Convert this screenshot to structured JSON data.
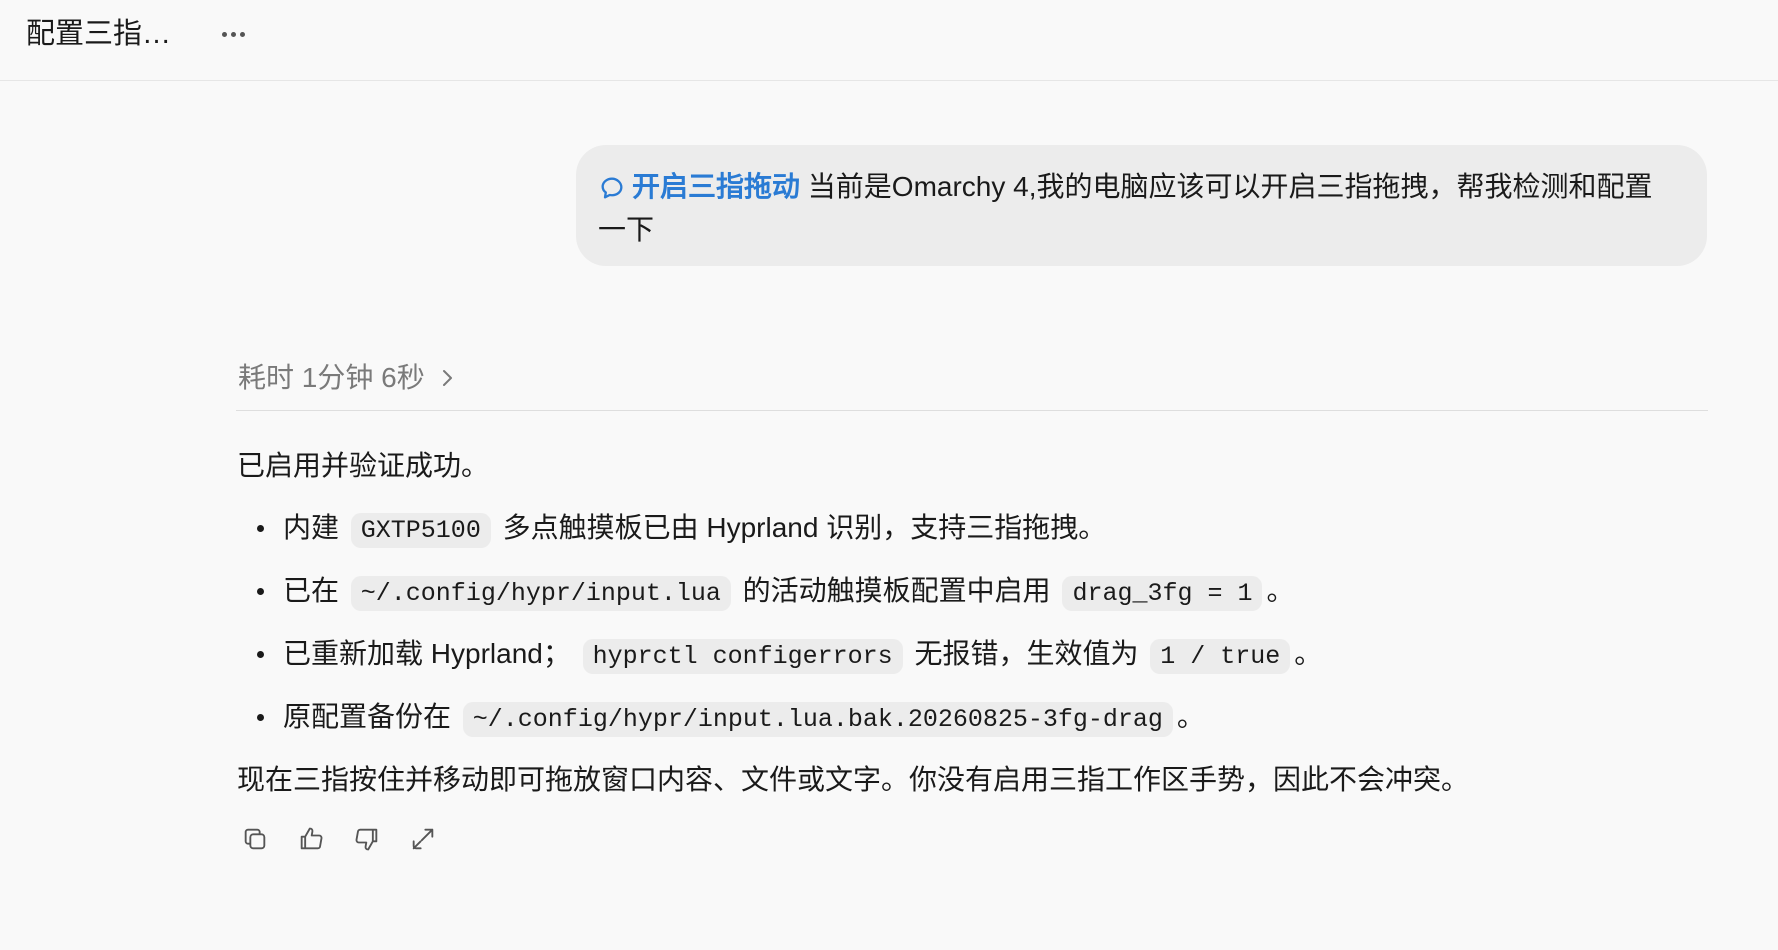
{
  "header": {
    "title": "配置三指…",
    "more_icon": "more-horizontal-icon"
  },
  "user_message": {
    "skill_icon": "chat-bubble-icon",
    "skill_label": "开启三指拖动",
    "text_line1": "当前是Omarchy 4,我的电脑应该可以开启三指拖拽，帮我检测和配置",
    "text_line2": "一下"
  },
  "assistant": {
    "elapsed": "耗时 1分钟 6秒",
    "elapsed_icon": "chevron-right-icon",
    "intro": "已启用并验证成功。",
    "bullets": [
      {
        "pre": "内建",
        "code1": "GXTP5100",
        "mid": "多点触摸板已由 Hyprland 识别，支持三指拖拽。"
      },
      {
        "pre": "已在",
        "code1": "~/.config/hypr/input.lua",
        "mid": "的活动触摸板配置中启用",
        "code2": "drag_3fg = 1",
        "post": "。"
      },
      {
        "pre": "已重新加载 Hyprland；",
        "code1": "hyprctl configerrors",
        "mid": "无报错，生效值为",
        "code2": "1 / true",
        "post": "。"
      },
      {
        "pre": "原配置备份在",
        "code1": "~/.config/hypr/input.lua.bak.20260825-3fg-drag",
        "post": "。"
      }
    ],
    "closing": "现在三指按住并移动即可拖放窗口内容、文件或文字。你没有启用三指工作区手势，因此不会冲突。"
  },
  "actions": {
    "copy_icon": "copy-icon",
    "like_icon": "thumbs-up-icon",
    "dislike_icon": "thumbs-down-icon",
    "share_icon": "share-icon"
  }
}
